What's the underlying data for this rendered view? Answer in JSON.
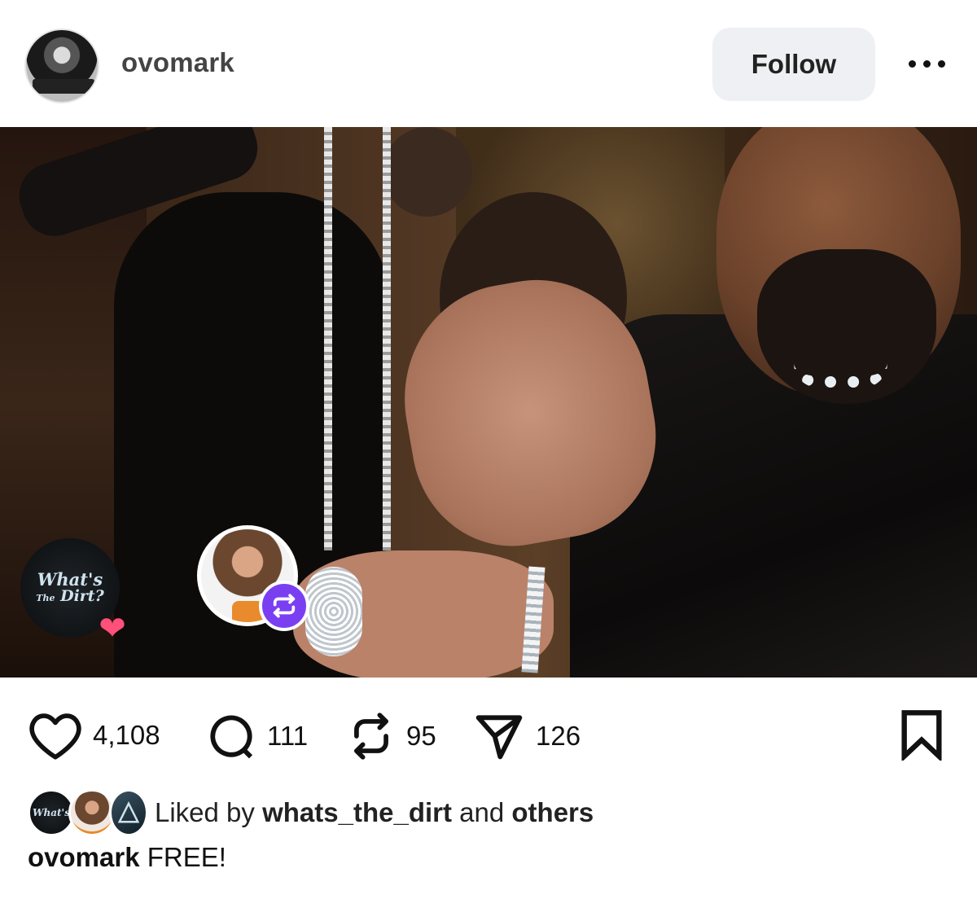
{
  "post": {
    "author": "ovomark",
    "follow_label": "Follow",
    "more_icon": "more-horizontal-icon"
  },
  "stickers": {
    "whats_the_dirt_line1": "What's",
    "whats_the_dirt_line2_small": "The",
    "whats_the_dirt_line2": "Dirt?",
    "heart_icon": "heart-icon",
    "repost_icon": "repost-icon"
  },
  "actions": {
    "likes": "4,108",
    "comments": "111",
    "reposts": "95",
    "shares": "126"
  },
  "liked_by": {
    "prefix": "Liked by",
    "user": "whats_the_dirt",
    "middle": "and",
    "others": "others"
  },
  "caption": {
    "author": "ovomark",
    "text": "FREE!"
  },
  "colors": {
    "accent_purple": "#7b3ff2",
    "heart_pink": "#ff4f7b",
    "follow_bg": "#eef0f3"
  }
}
